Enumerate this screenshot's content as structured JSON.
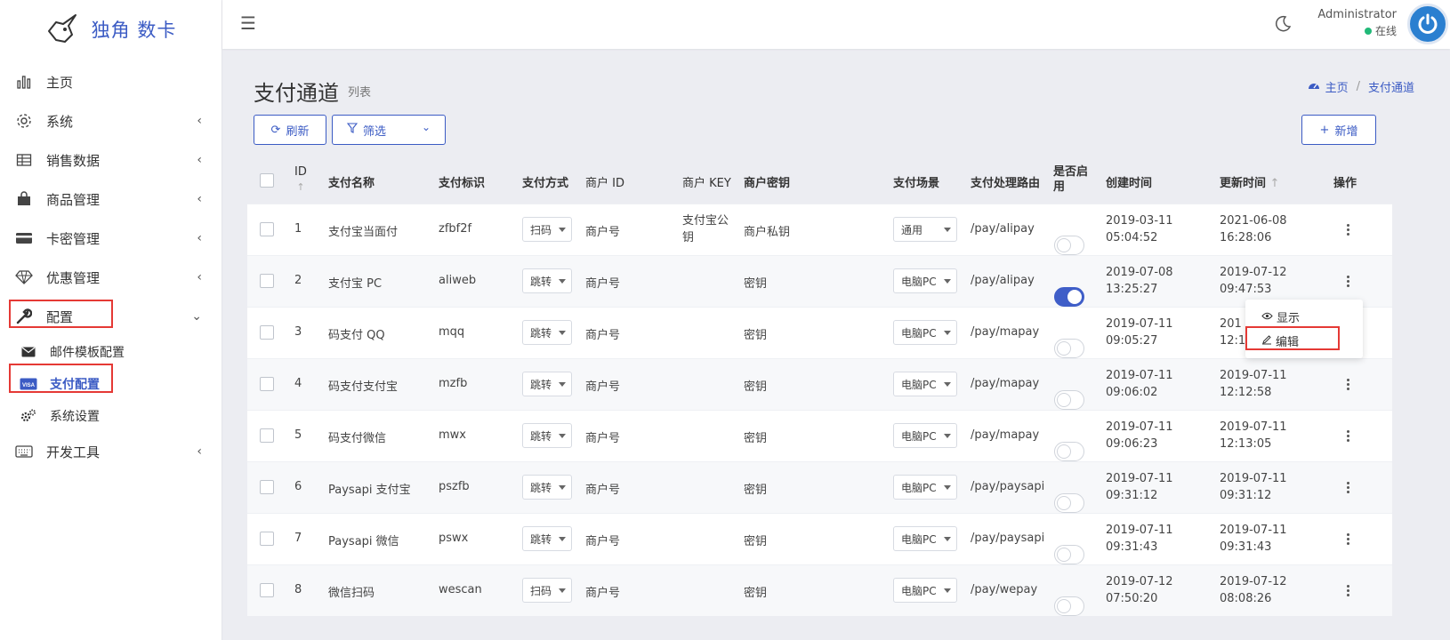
{
  "brand": {
    "text": "独角 数卡"
  },
  "sidebar": {
    "items": [
      {
        "label": "主页"
      },
      {
        "label": "系统"
      },
      {
        "label": "销售数据"
      },
      {
        "label": "商品管理"
      },
      {
        "label": "卡密管理"
      },
      {
        "label": "优惠管理"
      },
      {
        "label": "配置"
      },
      {
        "label": "开发工具"
      }
    ],
    "subitems": [
      {
        "label": "邮件模板配置"
      },
      {
        "label": "支付配置"
      },
      {
        "label": "系统设置"
      }
    ]
  },
  "topbar": {
    "user_name": "Administrator",
    "user_status": "在线"
  },
  "page": {
    "title": "支付通道",
    "subtitle": "列表"
  },
  "breadcrumb": {
    "home": "主页",
    "current": "支付通道"
  },
  "toolbar": {
    "refresh": "刷新",
    "filter": "筛选",
    "add": "新增"
  },
  "table": {
    "headers": {
      "id": "ID",
      "pay_name": "支付名称",
      "pay_check": "支付标识",
      "pay_method": "支付方式",
      "merchant_id": "商户 ID",
      "merchant_key": "商户 KEY",
      "merchant_pem": "商户密钥",
      "pay_client": "支付场景",
      "pay_handleroute": "支付处理路由",
      "is_open": "是否启用",
      "created_at": "创建时间",
      "updated_at": "更新时间",
      "actions": "操作"
    },
    "rows": [
      {
        "id": "1",
        "name": "支付宝当面付",
        "check": "zfbf2f",
        "method": "扫码",
        "merchant_id": "商户号",
        "merchant_key": "支付宝公钥",
        "pem": "商户私钥",
        "client": "通用",
        "route": "/pay/alipay",
        "enabled": false,
        "created_date": "2019-03-11",
        "created_time": "05:04:52",
        "updated_date": "2021-06-08",
        "updated_time": "16:28:06"
      },
      {
        "id": "2",
        "name": "支付宝 PC",
        "check": "aliweb",
        "method": "跳转",
        "merchant_id": "商户号",
        "merchant_key": "",
        "pem": "密钥",
        "client": "电脑PC",
        "route": "/pay/alipay",
        "enabled": true,
        "created_date": "2019-07-08",
        "created_time": "13:25:27",
        "updated_date": "2019-07-12",
        "updated_time": "09:47:53"
      },
      {
        "id": "3",
        "name": "码支付 QQ",
        "check": "mqq",
        "method": "跳转",
        "merchant_id": "商户号",
        "merchant_key": "",
        "pem": "密钥",
        "client": "电脑PC",
        "route": "/pay/mapay",
        "enabled": false,
        "created_date": "2019-07-11",
        "created_time": "09:05:27",
        "updated_date": "201",
        "updated_time": "12:1"
      },
      {
        "id": "4",
        "name": "码支付支付宝",
        "check": "mzfb",
        "method": "跳转",
        "merchant_id": "商户号",
        "merchant_key": "",
        "pem": "密钥",
        "client": "电脑PC",
        "route": "/pay/mapay",
        "enabled": false,
        "created_date": "2019-07-11",
        "created_time": "09:06:02",
        "updated_date": "2019-07-11",
        "updated_time": "12:12:58"
      },
      {
        "id": "5",
        "name": "码支付微信",
        "check": "mwx",
        "method": "跳转",
        "merchant_id": "商户号",
        "merchant_key": "",
        "pem": "密钥",
        "client": "电脑PC",
        "route": "/pay/mapay",
        "enabled": false,
        "created_date": "2019-07-11",
        "created_time": "09:06:23",
        "updated_date": "2019-07-11",
        "updated_time": "12:13:05"
      },
      {
        "id": "6",
        "name": "Paysapi 支付宝",
        "check": "pszfb",
        "method": "跳转",
        "merchant_id": "商户号",
        "merchant_key": "",
        "pem": "密钥",
        "client": "电脑PC",
        "route": "/pay/paysapi",
        "enabled": false,
        "created_date": "2019-07-11",
        "created_time": "09:31:12",
        "updated_date": "2019-07-11",
        "updated_time": "09:31:12"
      },
      {
        "id": "7",
        "name": "Paysapi 微信",
        "check": "pswx",
        "method": "跳转",
        "merchant_id": "商户号",
        "merchant_key": "",
        "pem": "密钥",
        "client": "电脑PC",
        "route": "/pay/paysapi",
        "enabled": false,
        "created_date": "2019-07-11",
        "created_time": "09:31:43",
        "updated_date": "2019-07-11",
        "updated_time": "09:31:43"
      },
      {
        "id": "8",
        "name": "微信扫码",
        "check": "wescan",
        "method": "扫码",
        "merchant_id": "商户号",
        "merchant_key": "",
        "pem": "密钥",
        "client": "电脑PC",
        "route": "/pay/wepay",
        "enabled": false,
        "created_date": "2019-07-12",
        "created_time": "07:50:20",
        "updated_date": "2019-07-12",
        "updated_time": "08:08:26"
      }
    ]
  },
  "dropdown": {
    "show": "显示",
    "edit": "编辑"
  },
  "colors": {
    "primary": "#3b5bc4",
    "highlight": "#e53935",
    "online": "#21b978"
  }
}
